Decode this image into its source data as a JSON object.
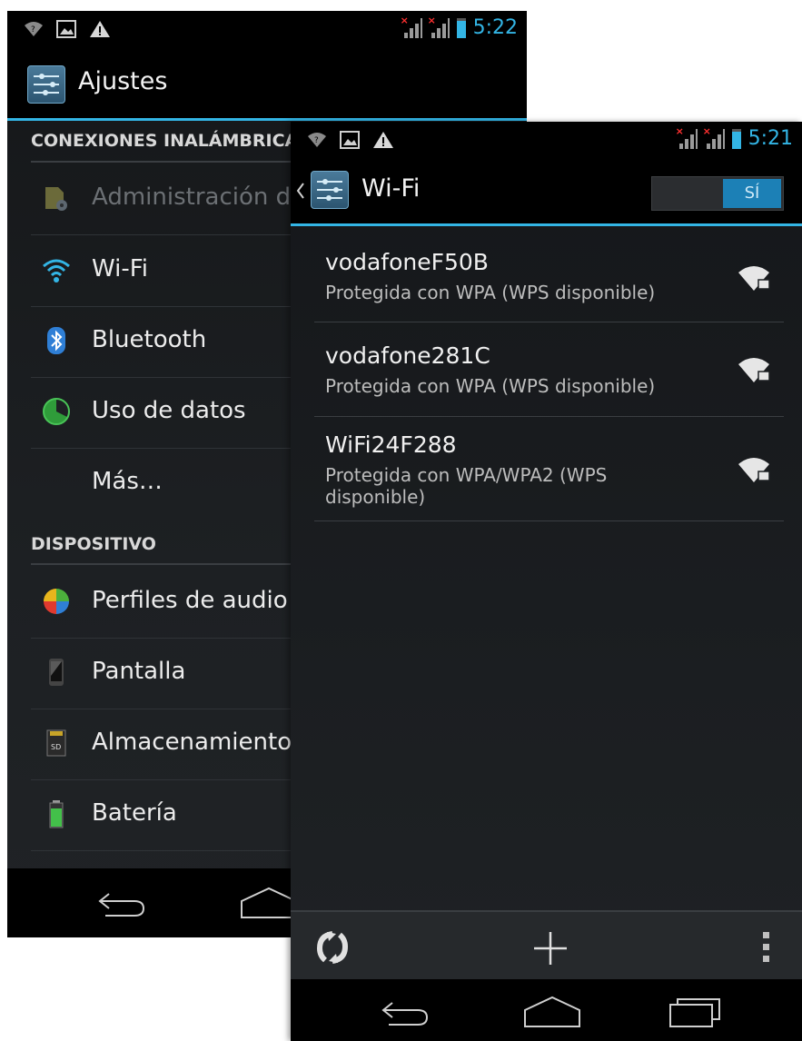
{
  "left_screen": {
    "status_time": "5:22",
    "title": "Ajustes",
    "sections": [
      {
        "header": "CONEXIONES INALÁMBRICAS"
      },
      {
        "header": "DISPOSITIVO"
      }
    ],
    "wireless_items": [
      {
        "label": "Administración de SIM",
        "icon": "sim-management-icon",
        "enabled": false
      },
      {
        "label": "Wi-Fi",
        "icon": "wifi-icon",
        "enabled": true
      },
      {
        "label": "Bluetooth",
        "icon": "bluetooth-icon",
        "enabled": true
      },
      {
        "label": "Uso de datos",
        "icon": "data-usage-icon",
        "enabled": true
      },
      {
        "label": "Más…",
        "icon": "",
        "enabled": true
      }
    ],
    "device_items": [
      {
        "label": "Perfiles de audio",
        "icon": "audio-profiles-icon"
      },
      {
        "label": "Pantalla",
        "icon": "display-icon"
      },
      {
        "label": "Almacenamiento",
        "icon": "sd-card-icon"
      },
      {
        "label": "Batería",
        "icon": "battery-icon"
      }
    ]
  },
  "right_screen": {
    "status_time": "5:21",
    "title": "Wi-Fi",
    "toggle_label": "SÍ",
    "networks": [
      {
        "ssid": "vodafoneF50B",
        "security": "Protegida con WPA (WPS disponible)"
      },
      {
        "ssid": "vodafone281C",
        "security": "Protegida con WPA (WPS disponible)"
      },
      {
        "ssid": "WiFi24F288",
        "security": "Protegida con WPA/WPA2 (WPS disponible)"
      }
    ],
    "bottom_actions": [
      "scan-icon",
      "add-network-icon",
      "overflow-menu-icon"
    ]
  },
  "colors": {
    "accent": "#33b5e5",
    "background": "#1c1f22",
    "toggle_on": "#1c80b6"
  }
}
